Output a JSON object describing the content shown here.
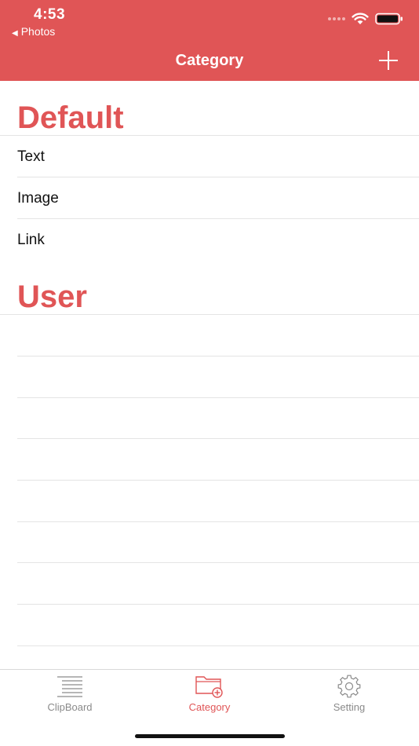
{
  "status_bar": {
    "time": "4:53",
    "back_label": "Photos"
  },
  "nav": {
    "title": "Category",
    "add_icon": "plus-icon"
  },
  "sections": {
    "default": {
      "header": "Default",
      "items": [
        "Text",
        "Image",
        "Link"
      ]
    },
    "user": {
      "header": "User",
      "items": []
    }
  },
  "tabbar": {
    "items": [
      {
        "label": "ClipBoard",
        "icon": "list-icon",
        "active": false
      },
      {
        "label": "Category",
        "icon": "folder-add-icon",
        "active": true
      },
      {
        "label": "Setting",
        "icon": "gear-icon",
        "active": false
      }
    ]
  },
  "colors": {
    "accent": "#e05556",
    "tab_inactive": "#8a8a8a",
    "separator": "#e4e4e4"
  }
}
